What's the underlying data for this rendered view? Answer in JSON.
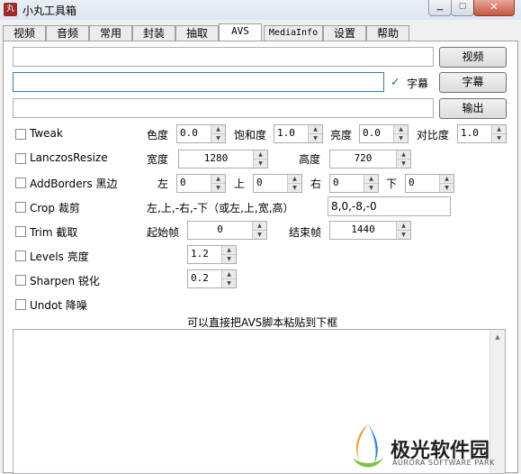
{
  "window": {
    "title": "小丸工具箱"
  },
  "tabs": [
    "视频",
    "音频",
    "常用",
    "封装",
    "抽取",
    "AVS",
    "MediaInfo",
    "设置",
    "帮助"
  ],
  "buttons": {
    "video": "视频",
    "subtitle": "字幕",
    "output": "输出"
  },
  "subtitle_checkbox": {
    "label": "字幕",
    "checked": true
  },
  "filters": {
    "tweak": {
      "label": "Tweak",
      "hue_label": "色度",
      "hue": "0.0",
      "sat_label": "饱和度",
      "sat": "1.0",
      "bright_label": "亮度",
      "bright": "0.0",
      "contrast_label": "对比度",
      "contrast": "1.0"
    },
    "lanczos": {
      "label": "LanczosResize",
      "width_label": "宽度",
      "width": "1280",
      "height_label": "高度",
      "height": "720"
    },
    "addborders": {
      "label": "AddBorders 黑边",
      "left_label": "左",
      "left": "0",
      "top_label": "上",
      "top": "0",
      "right_label": "右",
      "right": "0",
      "bottom_label": "下",
      "bottom": "0"
    },
    "crop": {
      "label": "Crop 裁剪",
      "hint": "左,上,-右,-下（或左,上,宽,高）",
      "value": "8,0,-8,-0"
    },
    "trim": {
      "label": "Trim 截取",
      "start_label": "起始帧",
      "start": "0",
      "end_label": "结束帧",
      "end": "1440"
    },
    "levels": {
      "label": "Levels 亮度",
      "value": "1.2"
    },
    "sharpen": {
      "label": "Sharpen 锐化",
      "value": "0.2"
    },
    "undot": {
      "label": "Undot 降噪"
    }
  },
  "script_hint": "可以直接把AVS脚本粘贴到下框",
  "watermark": {
    "name": "极光软件园",
    "sub": "AURORA SOFTWARE PARK"
  }
}
